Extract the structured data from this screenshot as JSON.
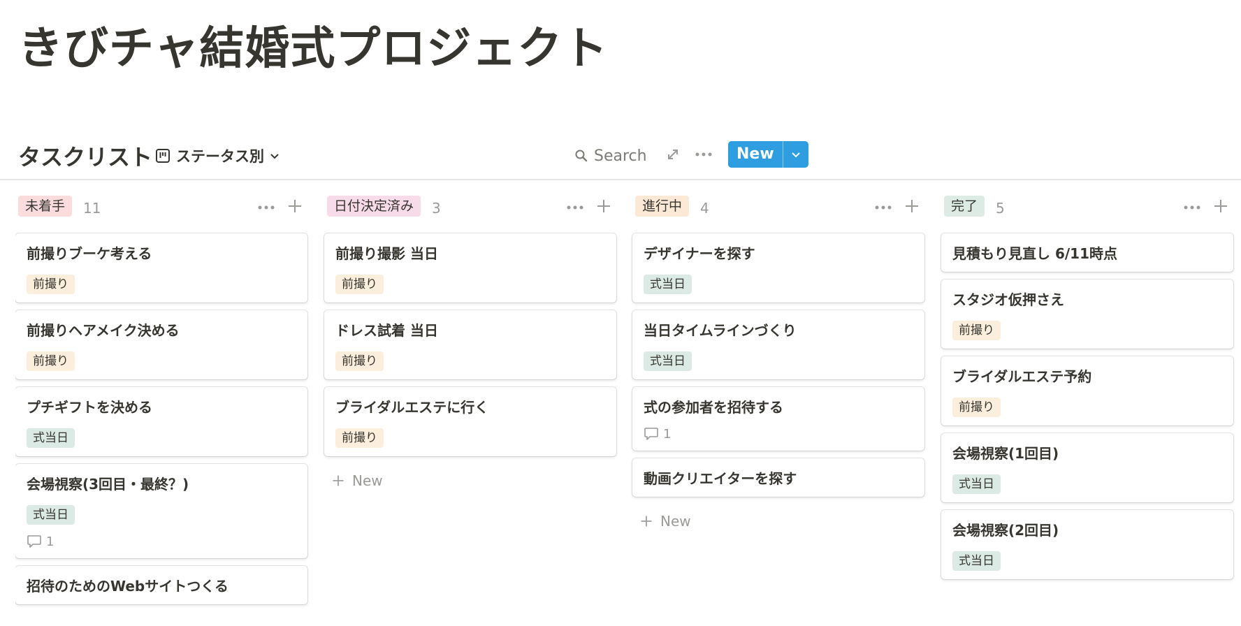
{
  "page": {
    "title": "きびチャ結婚式プロジェクト"
  },
  "database": {
    "title": "タスクリスト",
    "view_label": "ステータス別",
    "search_label": "Search",
    "new_button_label": "New",
    "add_new_label": "New"
  },
  "colors": {
    "tag_maedori": "#fbeedd",
    "tag_shikitoujitsu": "#dbeae4",
    "status_mitchakushu": "#fadcdc",
    "status_hizuke": "#f8dbe9",
    "status_shinkochu": "#fbe9d6",
    "status_kanryo": "#dcece5",
    "accent_blue": "#2f9ee0"
  },
  "columns": [
    {
      "label": "未着手",
      "count": "11",
      "color": "#fadcdc",
      "cards": [
        {
          "title": "前撮りブーケ考える",
          "tag": "前撮り",
          "tag_color": "#fbeedd"
        },
        {
          "title": "前撮りヘアメイク決める",
          "tag": "前撮り",
          "tag_color": "#fbeedd"
        },
        {
          "title": "プチギフトを決める",
          "tag": "式当日",
          "tag_color": "#dbeae4"
        },
        {
          "title": "会場視察(3回目・最終？)",
          "tag": "式当日",
          "tag_color": "#dbeae4",
          "comments": "1"
        },
        {
          "title": "招待のためのWebサイトつくる"
        }
      ]
    },
    {
      "label": "日付決定済み",
      "count": "3",
      "color": "#f8dbe9",
      "cards": [
        {
          "title": "前撮り撮影 当日",
          "tag": "前撮り",
          "tag_color": "#fbeedd"
        },
        {
          "title": "ドレス試着 当日",
          "tag": "前撮り",
          "tag_color": "#fbeedd"
        },
        {
          "title": "ブライダルエステに行く",
          "tag": "前撮り",
          "tag_color": "#fbeedd"
        }
      ],
      "add_new": true
    },
    {
      "label": "進行中",
      "count": "4",
      "color": "#fbe9d6",
      "cards": [
        {
          "title": "デザイナーを探す",
          "tag": "式当日",
          "tag_color": "#dbeae4"
        },
        {
          "title": "当日タイムラインづくり",
          "tag": "式当日",
          "tag_color": "#dbeae4"
        },
        {
          "title": "式の参加者を招待する",
          "comments": "1"
        },
        {
          "title": "動画クリエイターを探す"
        }
      ],
      "add_new": true
    },
    {
      "label": "完了",
      "count": "5",
      "color": "#dcece5",
      "cards": [
        {
          "title": "見積もり見直し 6/11時点"
        },
        {
          "title": "スタジオ仮押さえ",
          "tag": "前撮り",
          "tag_color": "#fbeedd"
        },
        {
          "title": "ブライダルエステ予約",
          "tag": "前撮り",
          "tag_color": "#fbeedd"
        },
        {
          "title": "会場視察(1回目)",
          "tag": "式当日",
          "tag_color": "#dbeae4"
        },
        {
          "title": "会場視察(2回目)",
          "tag": "式当日",
          "tag_color": "#dbeae4"
        }
      ]
    }
  ]
}
